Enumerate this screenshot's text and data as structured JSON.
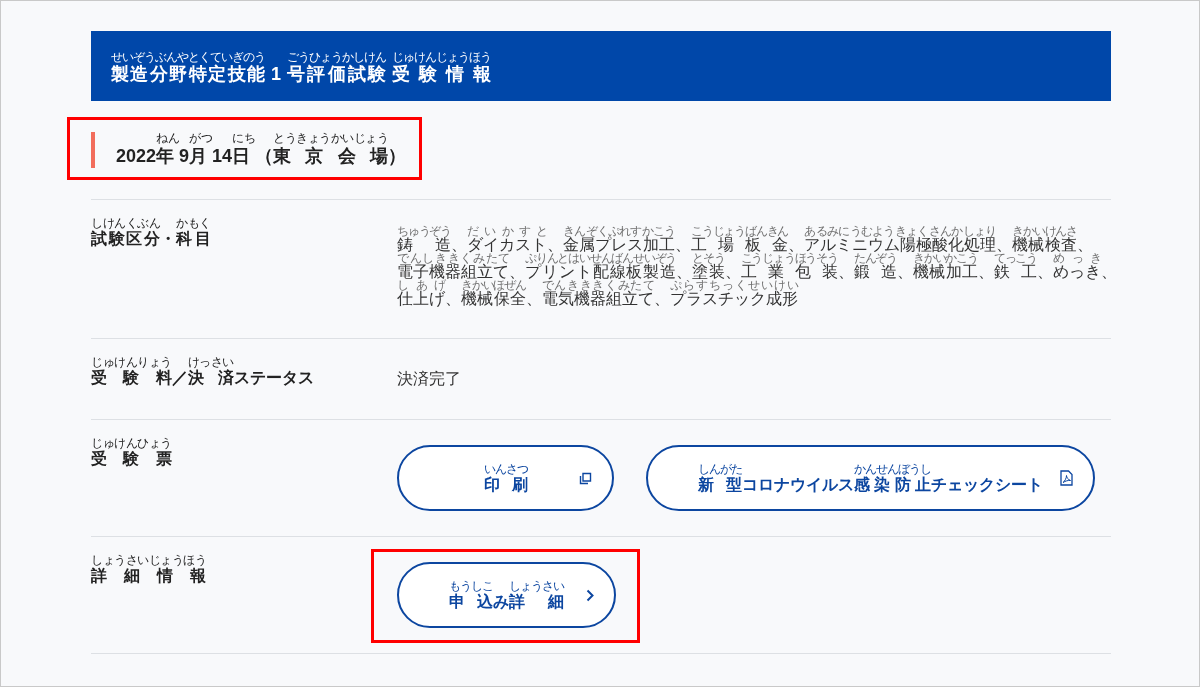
{
  "header": {
    "title": [
      {
        "text": "製造分野特定技能",
        "ruby": "せいぞうぶんやとくていぎのう"
      },
      {
        "text": "1"
      },
      {
        "text": "号評価試験",
        "ruby": "ごうひょうかしけん"
      },
      {
        "text": "受験情報",
        "ruby": "じゅけんじょうほう"
      }
    ]
  },
  "date_heading": {
    "highlighted": true,
    "text": [
      {
        "text": "2022"
      },
      {
        "text": "年",
        "ruby": "ねん"
      },
      {
        "text": "9"
      },
      {
        "text": "月",
        "ruby": "がつ"
      },
      {
        "text": "14"
      },
      {
        "text": "日",
        "ruby": "にち"
      },
      {
        "text": "（"
      },
      {
        "text": "東京会場",
        "ruby": "とうきょうかいじょう"
      },
      {
        "text": "）"
      }
    ]
  },
  "rows": [
    {
      "label": [
        {
          "text": "試験区分",
          "ruby": "しけんくぶん"
        },
        {
          "text": "・"
        },
        {
          "text": "科目",
          "ruby": "かもく"
        }
      ],
      "value": {
        "kind": "lines",
        "lines": [
          [
            {
              "text": "鋳造",
              "ruby": "ちゅうぞう"
            },
            {
              "text": "、"
            },
            {
              "text": "ダイカスト",
              "ruby": "だいかすと"
            },
            {
              "text": "、"
            },
            {
              "text": "金属プレス加工",
              "ruby": "きんぞくぷれすかこう"
            },
            {
              "text": "、"
            },
            {
              "text": "工場板金",
              "ruby": "こうじょうばんきん"
            },
            {
              "text": "、"
            },
            {
              "text": "アルミニウム陽極酸化処理",
              "ruby": "あるみにうむようきょくさんかしょり"
            },
            {
              "text": "、"
            },
            {
              "text": "機械検査",
              "ruby": "きかいけんさ"
            },
            {
              "text": "、"
            }
          ],
          [
            {
              "text": "電子機器組立て",
              "ruby": "でんしききくみたて"
            },
            {
              "text": "、"
            },
            {
              "text": "プリント配線板製造",
              "ruby": "ぷりんとはいせんばんせいぞう"
            },
            {
              "text": "、"
            },
            {
              "text": "塗装",
              "ruby": "とそう"
            },
            {
              "text": "、"
            },
            {
              "text": "工業包装",
              "ruby": "こうじょうほうそう"
            },
            {
              "text": "、"
            },
            {
              "text": "鍛造",
              "ruby": "たんぞう"
            },
            {
              "text": "、"
            },
            {
              "text": "機械加工",
              "ruby": "きかいかこう"
            },
            {
              "text": "、"
            },
            {
              "text": "鉄工",
              "ruby": "てっこう"
            },
            {
              "text": "、"
            },
            {
              "text": "めっき",
              "ruby": "めっき"
            },
            {
              "text": "、"
            }
          ],
          [
            {
              "text": "仕上げ",
              "ruby": "しあげ"
            },
            {
              "text": "、"
            },
            {
              "text": "機械保全",
              "ruby": "きかいほぜん"
            },
            {
              "text": "、"
            },
            {
              "text": "電気機器組立て",
              "ruby": "でんきききくみたて"
            },
            {
              "text": "、"
            },
            {
              "text": "プラスチック成形",
              "ruby": "ぷらすちっくせいけい"
            }
          ]
        ]
      }
    },
    {
      "label": [
        {
          "text": "受験料",
          "ruby": "じゅけんりょう"
        },
        {
          "text": "／"
        },
        {
          "text": "決済",
          "ruby": "けっさい"
        },
        {
          "text": "ステータス"
        }
      ],
      "value": {
        "kind": "text",
        "text": "決済完了"
      }
    },
    {
      "label": [
        {
          "text": "受験票",
          "ruby": "じゅけんひょう"
        }
      ],
      "value": {
        "kind": "buttons",
        "buttons": [
          {
            "kind": "print",
            "highlighted": false,
            "label": [
              {
                "text": "印刷",
                "ruby": "いんさつ"
              }
            ]
          },
          {
            "kind": "pdf",
            "highlighted": false,
            "label": [
              {
                "text": "新型",
                "ruby": "しんがた"
              },
              {
                "text": "コロナウイルス"
              },
              {
                "text": "感染防止",
                "ruby": "かんせんぼうし"
              },
              {
                "text": "チェックシート"
              }
            ]
          }
        ]
      }
    },
    {
      "label": [
        {
          "text": "詳細情報",
          "ruby": "しょうさいじょうほう"
        }
      ],
      "value": {
        "kind": "buttons",
        "buttons": [
          {
            "kind": "link",
            "highlighted": true,
            "label": [
              {
                "text": "申込",
                "ruby": "もうしこ"
              },
              {
                "text": "み"
              },
              {
                "text": "詳細",
                "ruby": "しょうさい"
              }
            ]
          }
        ]
      }
    }
  ]
}
